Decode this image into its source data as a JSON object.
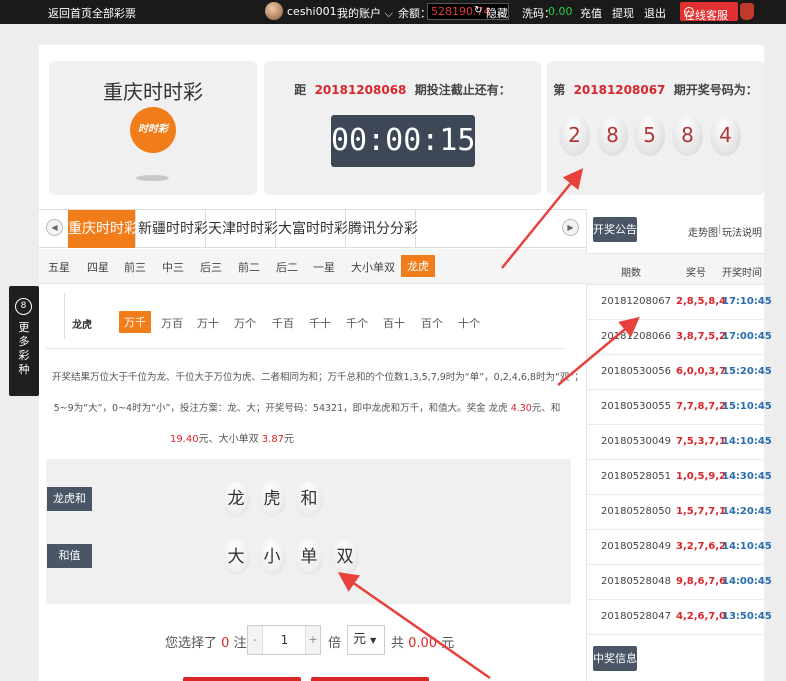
{
  "topbar": {
    "home": "返回首页",
    "sep": "|",
    "all_lotteries": "全部彩票",
    "username": "ceshi001",
    "my_account": "我的账户",
    "balance_label": "余额：",
    "balance_value": "528190.74",
    "hide": "隐藏",
    "wash_label": "洗码：",
    "wash_value": "0.00",
    "recharge": "充值",
    "withdraw": "提现",
    "logout": "退出",
    "customer_service": "在线客服"
  },
  "lottery": {
    "name": "重庆时时彩",
    "logo_text": "时时彩"
  },
  "countdown": {
    "prefix": "距",
    "issue": "20181208068",
    "suffix": "期投注截止还有：",
    "time": "00:00:15"
  },
  "draw": {
    "prefix": "第",
    "issue": "20181208067",
    "suffix": "期开奖号码为：",
    "balls": [
      "2",
      "8",
      "5",
      "8",
      "4"
    ]
  },
  "tabs": [
    "重庆时时彩",
    "新疆时时彩",
    "天津时时彩",
    "大富时时彩",
    "腾讯分分彩"
  ],
  "subtabs": [
    "五星",
    "四星",
    "前三",
    "中三",
    "后三",
    "前二",
    "后二",
    "一星",
    "大小单双",
    "龙虎"
  ],
  "positions": {
    "label": "龙虎",
    "options": [
      "万千",
      "万百",
      "万十",
      "万个",
      "千百",
      "千十",
      "千个",
      "百十",
      "百个",
      "十个"
    ]
  },
  "description": {
    "line1": "开奖结果万位大于千位为龙、千位大于万位为虎、二者相同为和；万千总和的个位数1,3,5,7,9时为“单”，0,2,4,6,8时为“双”；",
    "line2a": "5~9为“大”，0~4时为“小”，投注方案：龙、大；开奖号码：54321，即中龙虎和万千，和值大。奖金 龙虎 ",
    "odds1": "4.30",
    "line2b": "元、和",
    "odds2": "19.40",
    "line3a": "元、大小单双 ",
    "odds3": "3.87",
    "line3b": "元"
  },
  "pick": {
    "row1_label": "龙虎和",
    "row1_balls": [
      "龙",
      "虎",
      "和"
    ],
    "row2_label": "和值",
    "row2_balls": [
      "大",
      "小",
      "单",
      "双"
    ]
  },
  "bet": {
    "selected_prefix": "您选择了",
    "count": "0",
    "selected_suffix": "注,",
    "minus": "-",
    "multiplier": "1",
    "plus": "+",
    "times": "倍",
    "unit": "元",
    "total_prefix": "共",
    "total": "0.00",
    "total_suffix": "元"
  },
  "right_panel": {
    "announcement": "开奖公告",
    "trend": "走势图",
    "sep": "|",
    "rules": "玩法说明",
    "col_issue": "期数",
    "col_code": "奖号",
    "col_time": "开奖时间",
    "history": [
      {
        "issue": "20181208067",
        "code": "2,8,5,8,4",
        "time": "17:10:45"
      },
      {
        "issue": "20181208066",
        "code": "3,8,7,5,2",
        "time": "17:00:45"
      },
      {
        "issue": "20180530056",
        "code": "6,0,0,3,7",
        "time": "15:20:45"
      },
      {
        "issue": "20180530055",
        "code": "7,7,8,7,2",
        "time": "15:10:45"
      },
      {
        "issue": "20180530049",
        "code": "7,5,3,7,1",
        "time": "14:10:45"
      },
      {
        "issue": "20180528051",
        "code": "1,0,5,9,2",
        "time": "14:30:45"
      },
      {
        "issue": "20180528050",
        "code": "1,5,7,7,1",
        "time": "14:20:45"
      },
      {
        "issue": "20180528049",
        "code": "3,2,7,6,2",
        "time": "14:10:45"
      },
      {
        "issue": "20180528048",
        "code": "9,8,6,7,6",
        "time": "14:00:45"
      },
      {
        "issue": "20180528047",
        "code": "4,2,6,7,0",
        "time": "13:50:45"
      }
    ],
    "winners": "中奖信息"
  },
  "float_menu": {
    "num": "8",
    "text": "更多彩种"
  },
  "colors": {
    "accent": "#f07d1a",
    "brand_red": "#d9262b",
    "label_bg": "#4a5566",
    "annotation_arrow": "#e8413c"
  }
}
